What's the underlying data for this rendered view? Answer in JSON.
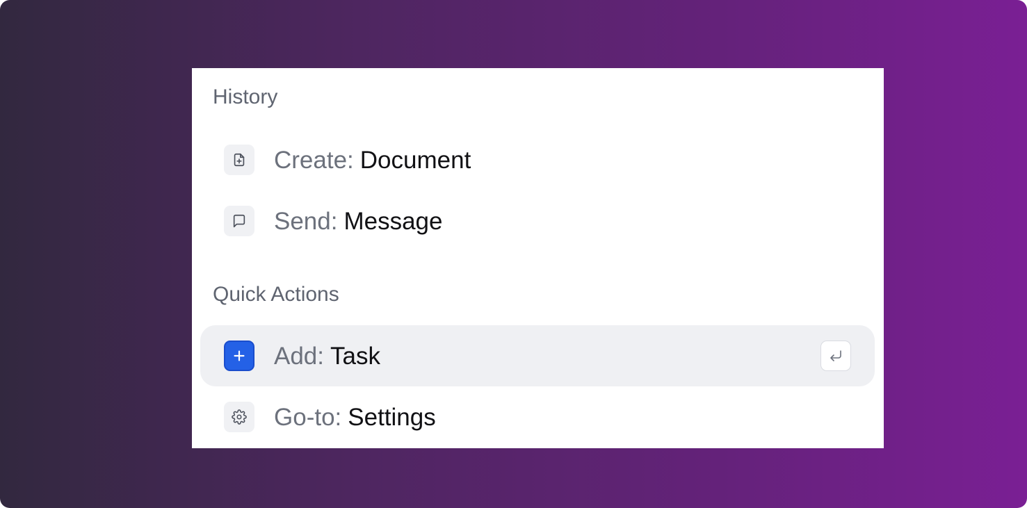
{
  "palette": {
    "accent": "#2461e6",
    "active_row": "#eff0f3",
    "background_gradient": [
      "#32283f",
      "#7a1f94"
    ]
  },
  "history": {
    "title": "History",
    "items": [
      {
        "verb": "Create:",
        "noun": "Document",
        "icon": "file-plus-icon"
      },
      {
        "verb": "Send:",
        "noun": "Message",
        "icon": "message-square-icon"
      }
    ]
  },
  "quick_actions": {
    "title": "Quick Actions",
    "items": [
      {
        "verb": "Add:",
        "noun": "Task",
        "icon": "plus-icon",
        "selected": true,
        "shortcut_icon": "enter-key-icon"
      },
      {
        "verb": "Go-to:",
        "noun": "Settings",
        "icon": "gear-icon"
      }
    ]
  }
}
